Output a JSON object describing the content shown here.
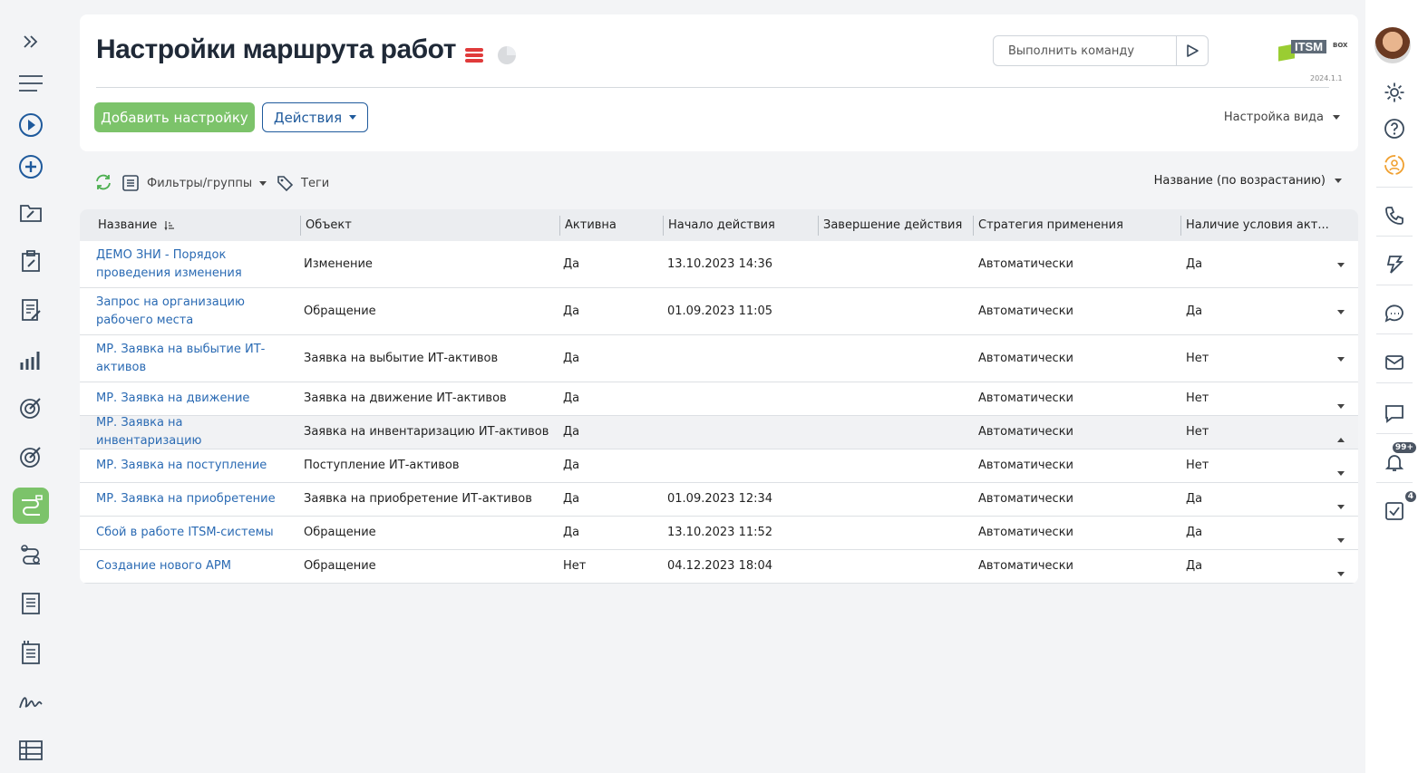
{
  "page": {
    "title": "Настройки маршрута работ",
    "command_placeholder": "Выполнить команду",
    "logo_text": "ITSM",
    "logo_box": "BOX",
    "version": "2024.1.1",
    "add_button": "Добавить настройку",
    "actions_button": "Действия",
    "view_settings": "Настройка вида"
  },
  "toolbar": {
    "filters": "Фильтры/группы",
    "tags": "Теги",
    "sort": "Название (по возрастанию)"
  },
  "columns": [
    "Название",
    "Объект",
    "Активна",
    "Начало действия",
    "Завершение действия",
    "Стратегия применения",
    "Наличие условия акт..."
  ],
  "rows": [
    {
      "name": "ДЕМО ЗНИ - Порядок проведения изменения",
      "object": "Изменение",
      "active": "Да",
      "start": "13.10.2023 14:36",
      "end": "",
      "strategy": "Автоматически",
      "condition": "Да"
    },
    {
      "name": "Запрос на организацию рабочего места",
      "object": "Обращение",
      "active": "Да",
      "start": "01.09.2023 11:05",
      "end": "",
      "strategy": "Автоматически",
      "condition": "Да"
    },
    {
      "name": "МР. Заявка на выбытие ИТ-активов",
      "object": "Заявка на выбытие ИТ-активов",
      "active": "Да",
      "start": "",
      "end": "",
      "strategy": "Автоматически",
      "condition": "Нет"
    },
    {
      "name": "МР. Заявка на движение",
      "object": "Заявка на движение ИТ-активов",
      "active": "Да",
      "start": "",
      "end": "",
      "strategy": "Автоматически",
      "condition": "Нет"
    },
    {
      "name": "МР. Заявка на инвентаризацию",
      "object": "Заявка на инвентаризацию ИТ-активов",
      "active": "Да",
      "start": "",
      "end": "",
      "strategy": "Автоматически",
      "condition": "Нет"
    },
    {
      "name": "МР. Заявка на поступление",
      "object": "Поступление ИТ-активов",
      "active": "Да",
      "start": "",
      "end": "",
      "strategy": "Автоматически",
      "condition": "Нет"
    },
    {
      "name": "МР. Заявка на приобретение",
      "object": "Заявка на приобретение ИТ-активов",
      "active": "Да",
      "start": "01.09.2023 12:34",
      "end": "",
      "strategy": "Автоматически",
      "condition": "Да"
    },
    {
      "name": "Сбой в работе ITSM-системы",
      "object": "Обращение",
      "active": "Да",
      "start": "13.10.2023 11:52",
      "end": "",
      "strategy": "Автоматически",
      "condition": "Да"
    },
    {
      "name": "Создание нового АРМ",
      "object": "Обращение",
      "active": "Нет",
      "start": "04.12.2023 18:04",
      "end": "",
      "strategy": "Автоматически",
      "condition": "Да"
    }
  ],
  "badges": {
    "notifications": "99+",
    "tasks": "4"
  },
  "colors": {
    "accent_green": "#7cc36a",
    "link_blue": "#2a6ab3",
    "outline_blue": "#1f5a9c",
    "menu_red": "#e03a3a"
  }
}
